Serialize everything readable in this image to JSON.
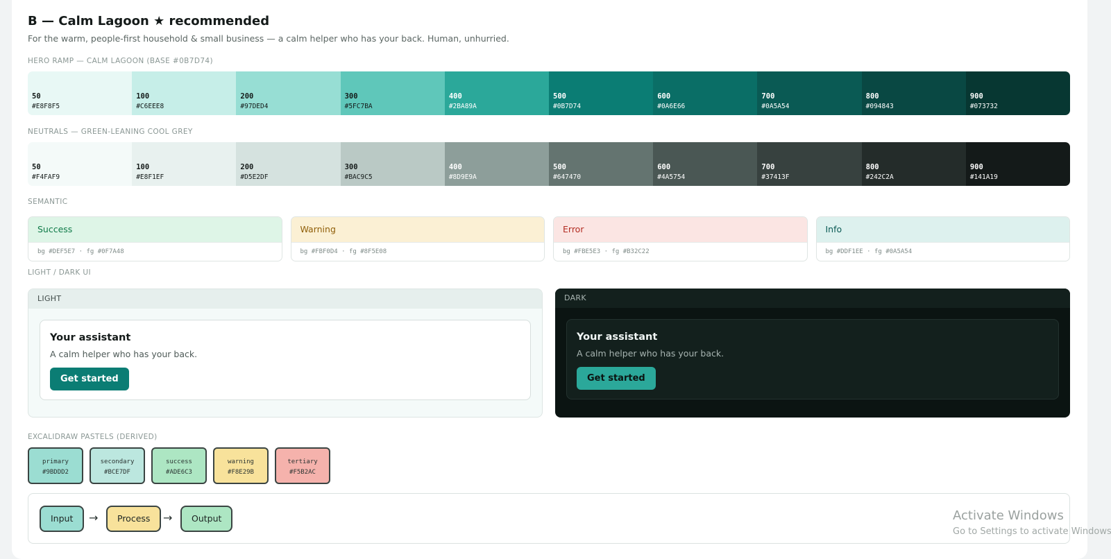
{
  "header": {
    "title": "B — Calm Lagoon ★ recommended",
    "subtitle": "For the warm, people-first household & small business — a calm helper who has your back. Human, unhurried."
  },
  "hero_ramp": {
    "label": "HERO RAMP — CALM LAGOON (BASE #0B7D74)",
    "swatches": [
      {
        "step": "50",
        "hex": "#E8F8F5",
        "color": "#E8F8F5",
        "text_color": "#141a19"
      },
      {
        "step": "100",
        "hex": "#C6EEE8",
        "color": "#C6EEE8",
        "text_color": "#141a19"
      },
      {
        "step": "200",
        "hex": "#97DED4",
        "color": "#97DED4",
        "text_color": "#141a19"
      },
      {
        "step": "300",
        "hex": "#5FC7BA",
        "color": "#5FC7BA",
        "text_color": "#141a19"
      },
      {
        "step": "400",
        "hex": "#2BA89A",
        "color": "#2BA89A",
        "text_color": "#ffffff"
      },
      {
        "step": "500",
        "hex": "#0B7D74",
        "color": "#0B7D74",
        "text_color": "#ffffff"
      },
      {
        "step": "600",
        "hex": "#0A6E66",
        "color": "#0A6E66",
        "text_color": "#ffffff"
      },
      {
        "step": "700",
        "hex": "#0A5A54",
        "color": "#0A5A54",
        "text_color": "#ffffff"
      },
      {
        "step": "800",
        "hex": "#094843",
        "color": "#094843",
        "text_color": "#ffffff"
      },
      {
        "step": "900",
        "hex": "#073732",
        "color": "#073732",
        "text_color": "#ffffff"
      }
    ]
  },
  "neutrals": {
    "label": "NEUTRALS — GREEN-LEANING COOL GREY",
    "swatches": [
      {
        "step": "50",
        "hex": "#F4FAF9",
        "color": "#F4FAF9",
        "text_color": "#141a19"
      },
      {
        "step": "100",
        "hex": "#E8F1EF",
        "color": "#E8F1EF",
        "text_color": "#141a19"
      },
      {
        "step": "200",
        "hex": "#D5E2DF",
        "color": "#D5E2DF",
        "text_color": "#141a19"
      },
      {
        "step": "300",
        "hex": "#BAC9C5",
        "color": "#BAC9C5",
        "text_color": "#141a19"
      },
      {
        "step": "400",
        "hex": "#8D9E9A",
        "color": "#8D9E9A",
        "text_color": "#ffffff"
      },
      {
        "step": "500",
        "hex": "#647470",
        "color": "#647470",
        "text_color": "#ffffff"
      },
      {
        "step": "600",
        "hex": "#4A5754",
        "color": "#4A5754",
        "text_color": "#ffffff"
      },
      {
        "step": "700",
        "hex": "#37413F",
        "color": "#37413F",
        "text_color": "#ffffff"
      },
      {
        "step": "800",
        "hex": "#242C2A",
        "color": "#242C2A",
        "text_color": "#ffffff"
      },
      {
        "step": "900",
        "hex": "#141A19",
        "color": "#141A19",
        "text_color": "#ffffff"
      }
    ]
  },
  "semantic": {
    "label": "SEMANTIC",
    "items": [
      {
        "name": "Success",
        "bg": "#DEF5E7",
        "fg": "#0F7A48",
        "meta": "bg #DEF5E7 · fg #0F7A48"
      },
      {
        "name": "Warning",
        "bg": "#FBF0D4",
        "fg": "#8F5E08",
        "meta": "bg #FBF0D4 · fg #8F5E08"
      },
      {
        "name": "Error",
        "bg": "#FBE5E3",
        "fg": "#B32C22",
        "meta": "bg #FBE5E3 · fg #B32C22"
      },
      {
        "name": "Info",
        "bg": "#DDF1EE",
        "fg": "#0A5A54",
        "meta": "bg #DDF1EE · fg #0A5A54"
      }
    ]
  },
  "ui_preview": {
    "label": "LIGHT / DARK UI",
    "light": {
      "header": "LIGHT",
      "title": "Your assistant",
      "subtitle": "A calm helper who has your back.",
      "button": "Get started"
    },
    "dark": {
      "header": "DARK",
      "title": "Your assistant",
      "subtitle": "A calm helper who has your back.",
      "button": "Get started"
    }
  },
  "pastels": {
    "label": "EXCALIDRAW PASTELS (DERIVED)",
    "items": [
      {
        "name": "primary",
        "hex": "#9BDDD2",
        "color": "#9BDDD2"
      },
      {
        "name": "secondary",
        "hex": "#BCE7DF",
        "color": "#BCE7DF"
      },
      {
        "name": "success",
        "hex": "#ADE6C3",
        "color": "#ADE6C3"
      },
      {
        "name": "warning",
        "hex": "#F8E29B",
        "color": "#F8E29B"
      },
      {
        "name": "tertiary",
        "hex": "#F5B2AC",
        "color": "#F5B2AC"
      }
    ]
  },
  "flow": {
    "nodes": [
      {
        "label": "Input",
        "color": "#9BDDD2"
      },
      {
        "label": "Process",
        "color": "#F8E29B"
      },
      {
        "label": "Output",
        "color": "#ADE6C3"
      }
    ],
    "arrow": "→"
  },
  "os_overlay": {
    "title": "Activate Windows",
    "subtitle": "Go to Settings to activate Windows."
  }
}
